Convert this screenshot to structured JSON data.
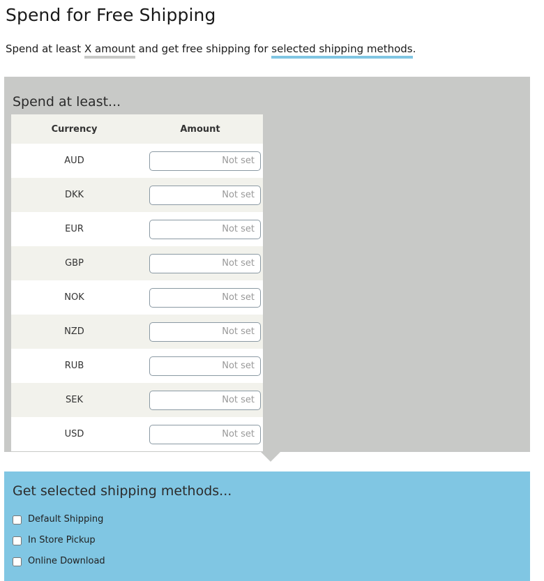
{
  "header": {
    "title": "Spend for Free Shipping",
    "subtitle_parts": {
      "lead": "Spend at least ",
      "highlight_amount": "X amount",
      "middle": " and get free shipping for ",
      "highlight_methods": "selected shipping methods",
      "trailing": "."
    }
  },
  "spend_panel": {
    "heading": "Spend at least...",
    "table": {
      "columns": [
        "Currency",
        "Amount"
      ],
      "rows": [
        {
          "currency": "AUD",
          "amount": "",
          "placeholder": "Not set"
        },
        {
          "currency": "DKK",
          "amount": "",
          "placeholder": "Not set"
        },
        {
          "currency": "EUR",
          "amount": "",
          "placeholder": "Not set"
        },
        {
          "currency": "GBP",
          "amount": "",
          "placeholder": "Not set"
        },
        {
          "currency": "NOK",
          "amount": "",
          "placeholder": "Not set"
        },
        {
          "currency": "NZD",
          "amount": "",
          "placeholder": "Not set"
        },
        {
          "currency": "RUB",
          "amount": "",
          "placeholder": "Not set"
        },
        {
          "currency": "SEK",
          "amount": "",
          "placeholder": "Not set"
        },
        {
          "currency": "USD",
          "amount": "",
          "placeholder": "Not set"
        }
      ]
    }
  },
  "methods_panel": {
    "heading": "Get selected shipping methods...",
    "options": [
      {
        "label": "Default Shipping",
        "checked": false
      },
      {
        "label": "In Store Pickup",
        "checked": false
      },
      {
        "label": "Online Download",
        "checked": false
      }
    ]
  },
  "colors": {
    "gray_panel": "#c8c9c7",
    "blue_panel": "#80c6e3",
    "table_header": "#f2f2ec",
    "row_alt": "#f2f2ec",
    "checkbox_border": "#3a9fd4",
    "input_border": "#8a99a3"
  }
}
